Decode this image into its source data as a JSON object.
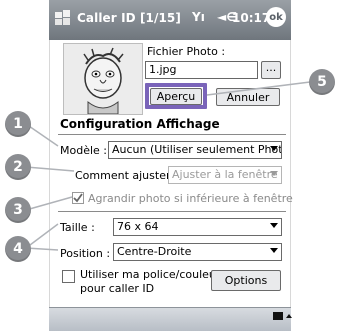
{
  "titlebar": {
    "title": "Caller ID [1/15]",
    "signal": "Yı",
    "volume": "◄∈",
    "time": "10:17",
    "ok_label": "ok"
  },
  "photo": {
    "file_label": "Fichier Photo :",
    "file_value": "1.jpg",
    "browse_label": "...",
    "preview_button": "Aperçu",
    "cancel_button": "Annuler"
  },
  "section": {
    "title": "Configuration Affichage"
  },
  "fields": {
    "model_label": "Modèle :",
    "model_value": "Aucun (Utiliser seulement Photo)",
    "adjust_label": "Comment ajuster:",
    "adjust_value": "Ajuster à la fenêtre",
    "enlarge_label": "Agrandir photo si inférieure à fenêtre",
    "size_label": "Taille :",
    "size_value": "76 x 64",
    "position_label": "Position :",
    "position_value": "Centre-Droite",
    "use_font_label_1": "Utiliser ma police/couleur",
    "use_font_label_2": "pour caller ID",
    "options_button": "Options"
  },
  "callouts": [
    "1",
    "2",
    "3",
    "4",
    "5"
  ],
  "colors": {
    "callout": "#8b8d91",
    "highlight": "#7a64b9"
  }
}
